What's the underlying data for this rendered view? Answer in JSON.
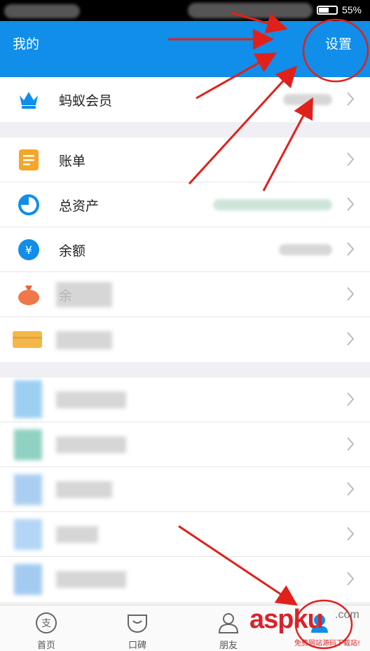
{
  "status_bar": {
    "battery_percent": "55%",
    "battery_level": 0.55
  },
  "header": {
    "title": "我的",
    "settings_label": "设置"
  },
  "groups": [
    [
      {
        "icon": "crown-icon",
        "label": "蚂蚁会员"
      }
    ],
    [
      {
        "icon": "bill-icon",
        "label": "账单"
      },
      {
        "icon": "pie-chart-icon",
        "label": "总资产"
      },
      {
        "icon": "yuan-icon",
        "label": "余额"
      },
      {
        "icon": "money-bag-icon",
        "label": "余"
      },
      {
        "icon": "wallet-icon",
        "label": ""
      }
    ],
    [
      {
        "icon": "blurred-icon",
        "label": ""
      },
      {
        "icon": "blurred-icon",
        "label": ""
      },
      {
        "icon": "blurred-icon",
        "label": ""
      },
      {
        "icon": "blurred-icon",
        "label": ""
      },
      {
        "icon": "blurred-icon",
        "label": ""
      }
    ]
  ],
  "tabs": [
    {
      "icon": "alipay-icon",
      "label": "首页"
    },
    {
      "icon": "koubei-icon",
      "label": "口碑"
    },
    {
      "icon": "friends-icon",
      "label": "朋友"
    },
    {
      "icon": "mine-icon",
      "label": ""
    }
  ],
  "watermark": {
    "brand": "aspku",
    "domain": ".com",
    "tagline": "免费网站源码下载站!"
  },
  "colors": {
    "header": "#108ee9",
    "arrow": "#e0211b",
    "icon_blue": "#108ee9",
    "icon_orange": "#f4a52a"
  }
}
